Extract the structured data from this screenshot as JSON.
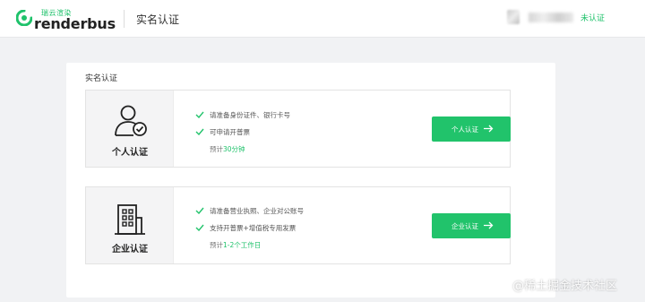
{
  "header": {
    "logo_cn": "瑞云渲染",
    "logo_en": "renderbus",
    "page_title": "实名认证",
    "status_label": "未认证"
  },
  "panel": {
    "section_title": "实名认证",
    "cards": [
      {
        "name": "个人认证",
        "icon": "person-verified-icon",
        "features": [
          "请准备身份证件、银行卡号",
          "可申请开普票"
        ],
        "estimate_prefix": "预计",
        "estimate_value": "30分钟",
        "button_label": "个人认证"
      },
      {
        "name": "企业认证",
        "icon": "building-icon",
        "features": [
          "请准备营业执照、企业对公账号",
          "支持开普票+增值税专用发票"
        ],
        "estimate_prefix": "预计",
        "estimate_value": "1-2个工作日",
        "button_label": "企业认证"
      }
    ]
  },
  "watermark": "@稀土掘金技术社区",
  "colors": {
    "accent": "#21c36b",
    "background": "#f1f2f4",
    "card_side": "#f4f4f5"
  }
}
